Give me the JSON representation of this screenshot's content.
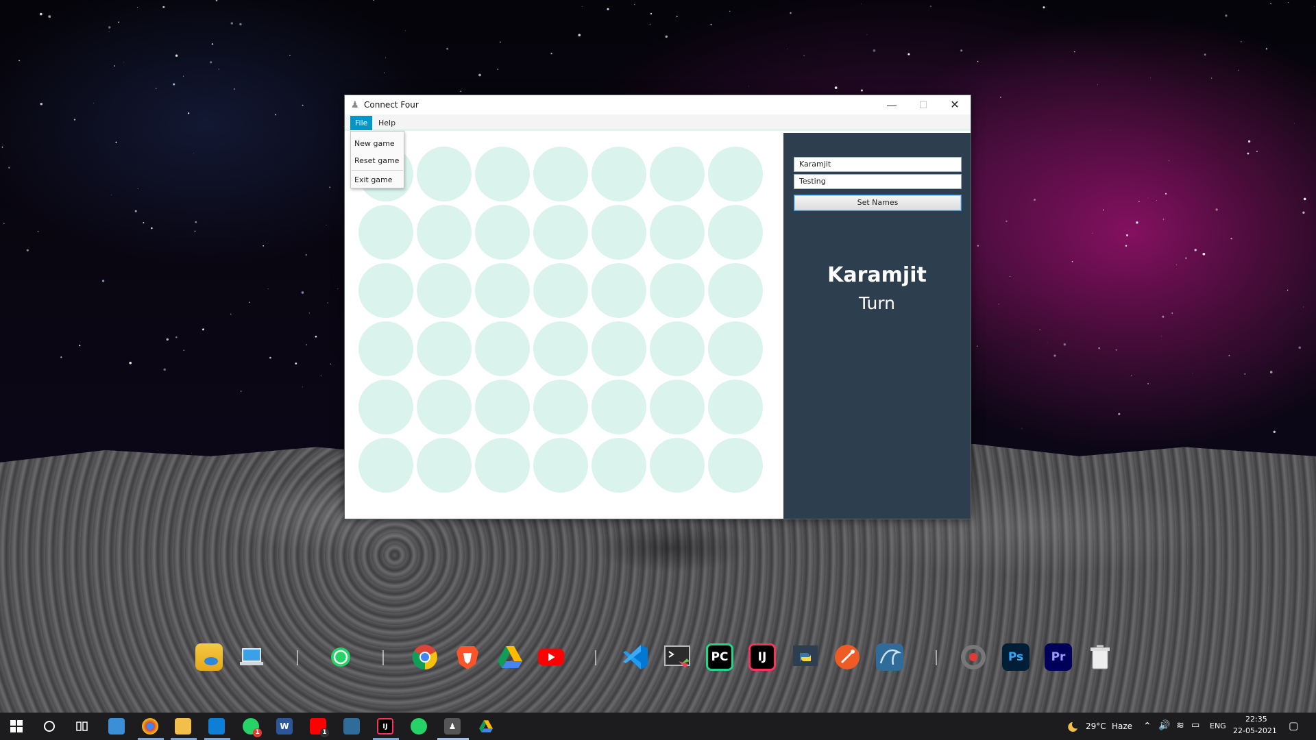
{
  "window": {
    "title": "Connect Four",
    "minimize_glyph": "—",
    "maximize_glyph": "☐",
    "close_glyph": "✕"
  },
  "menu": {
    "file_label": "File",
    "help_label": "Help",
    "file_items": [
      "New game",
      "Reset game",
      "Exit game"
    ]
  },
  "board": {
    "rows": 6,
    "columns": 7,
    "empty_cell_color": "#dbf3ed"
  },
  "side_panel": {
    "player_one_name": "Karamjit",
    "player_two_name": "Testing",
    "set_names_label": "Set Names",
    "current_player": "Karamjit",
    "turn_label": "Turn",
    "background_color": "#2d3e4e"
  },
  "dock": {
    "icons": [
      "folder-cloud-icon",
      "laptop-icon",
      "whatsapp-icon",
      "chrome-icon",
      "brave-icon",
      "google-drive-icon",
      "youtube-icon",
      "vscode-icon",
      "terminal-icon",
      "pycharm-icon",
      "intellij-icon",
      "python-icon",
      "postman-icon",
      "mysql-workbench-icon",
      "settings-icon",
      "photoshop-icon",
      "premiere-icon",
      "recycle-bin-icon"
    ],
    "labels": {
      "pycharm": "PC",
      "intellij": "IJ",
      "photoshop": "Ps",
      "premiere": "Pr"
    }
  },
  "taskbar": {
    "weather_temp": "29°C",
    "weather_desc": "Haze",
    "language": "ENG",
    "time": "22:35",
    "date": "22-05-2021",
    "whatsapp_badge": "1",
    "youtube_badge": "1"
  }
}
